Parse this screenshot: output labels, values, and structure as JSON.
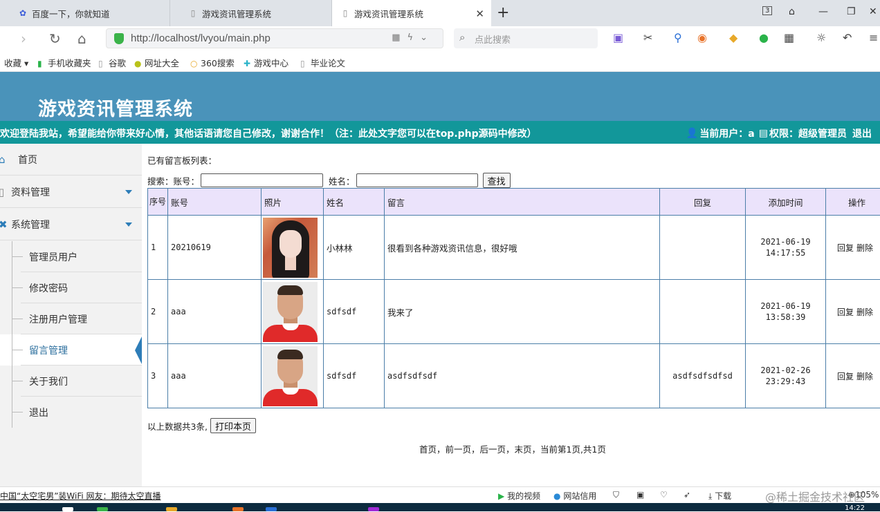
{
  "browser": {
    "tabs": [
      {
        "title": "百度一下，你就知道",
        "icon": "baidu-paw-icon"
      },
      {
        "title": "游戏资讯管理系统",
        "icon": "page-icon"
      },
      {
        "title": "游戏资讯管理系统",
        "icon": "page-icon",
        "active": true
      }
    ],
    "url": "http://localhost/lvyou/main.php",
    "search_placeholder": "点此搜索",
    "bookmarks": [
      "收藏",
      "手机收藏夹",
      "谷歌",
      "网址大全",
      "360搜索",
      "游戏中心",
      "毕业论文"
    ]
  },
  "site": {
    "title": "游戏资讯管理系统",
    "welcome": "欢迎登陆我站，希望能给你带来好心情，其他话语请您自己修改，谢谢合作！（注：此处文字您可以在top.php源码中修改）",
    "current_user_label": "当前用户：a",
    "role_label": "权限：超级管理员",
    "logout": "退出",
    "header_color": "#4a93ba",
    "bar_color": "#12979a"
  },
  "sidebar": {
    "main": [
      {
        "label": "首页",
        "icon": "home-icon"
      },
      {
        "label": "资料管理",
        "icon": "document-icon"
      },
      {
        "label": "系统管理",
        "icon": "wrench-icon"
      }
    ],
    "sub": [
      "管理员用户",
      "修改密码",
      "注册用户管理",
      "留言管理",
      "关于我们",
      "退出"
    ],
    "active_sub": "留言管理"
  },
  "content": {
    "list_title": "已有留言板列表：",
    "search_label": "搜索：账号：",
    "name_label": "姓名：",
    "search_button": "查找",
    "columns": [
      "序号",
      "账号",
      "照片",
      "姓名",
      "留言",
      "回复",
      "添加时间",
      "操作"
    ],
    "rows": [
      {
        "no": "1",
        "account": "20210619",
        "name": "小林林",
        "message": "很看到各种游戏资讯信息，很好哦",
        "reply": "",
        "time1": "2021-06-19",
        "time2": "14:17:55",
        "photo": "girl"
      },
      {
        "no": "2",
        "account": "aaa",
        "name": "sdfsdf",
        "message": "我来了",
        "reply": "",
        "time1": "2021-06-19",
        "time2": "13:58:39",
        "photo": "man"
      },
      {
        "no": "3",
        "account": "aaa",
        "name": "sdfsdf",
        "message": "asdfsdfsdf",
        "reply": "asdfsdfsdfsd",
        "time1": "2021-02-26",
        "time2": "23:29:43",
        "photo": "man"
      }
    ],
    "op_reply": "回复",
    "op_delete": "删除",
    "total_text": "以上数据共3条,",
    "print_button": "打印本页",
    "pager": "首页，前一页，后一页，末页，当前第1页,共1页"
  },
  "statusbar": {
    "news": "中国“太空宅男”装WiFi 网友：期待太空直播",
    "video": "我的视频",
    "credit": "网站信用",
    "download": "下载",
    "zoom": "105%",
    "clock": "14:22"
  },
  "watermark": "@稀土掘金技术社区"
}
